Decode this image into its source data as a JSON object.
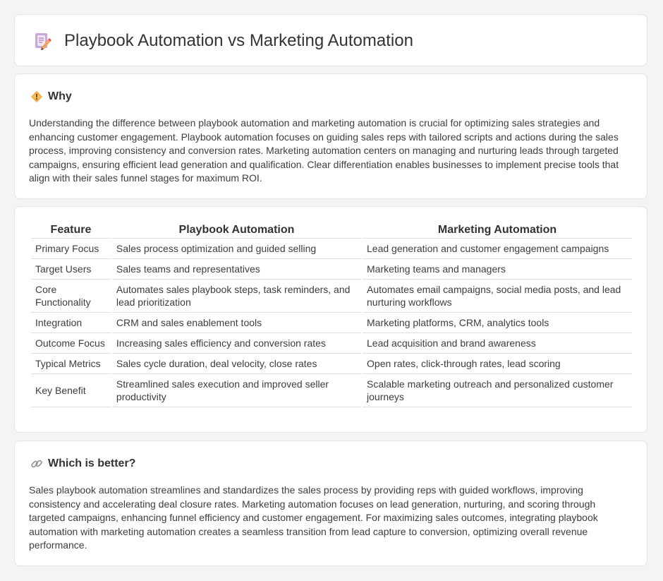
{
  "header": {
    "title": "Playbook Automation vs Marketing Automation"
  },
  "why": {
    "title": "Why",
    "text": "Understanding the difference between playbook automation and marketing automation is crucial for optimizing sales strategies and enhancing customer engagement. Playbook automation focuses on guiding sales reps with tailored scripts and actions during the sales process, improving consistency and conversion rates. Marketing automation centers on managing and nurturing leads through targeted campaigns, ensuring efficient lead generation and qualification. Clear differentiation enables businesses to implement precise tools that align with their sales funnel stages for maximum ROI."
  },
  "table": {
    "headers": [
      "Feature",
      "Playbook Automation",
      "Marketing Automation"
    ],
    "rows": [
      [
        "Primary Focus",
        "Sales process optimization and guided selling",
        "Lead generation and customer engagement campaigns"
      ],
      [
        "Target Users",
        "Sales teams and representatives",
        "Marketing teams and managers"
      ],
      [
        "Core Functionality",
        "Automates sales playbook steps, task reminders, and lead prioritization",
        "Automates email campaigns, social media posts, and lead nurturing workflows"
      ],
      [
        "Integration",
        "CRM and sales enablement tools",
        "Marketing platforms, CRM, analytics tools"
      ],
      [
        "Outcome Focus",
        "Increasing sales efficiency and conversion rates",
        "Lead acquisition and brand awareness"
      ],
      [
        "Typical Metrics",
        "Sales cycle duration, deal velocity, close rates",
        "Open rates, click-through rates, lead scoring"
      ],
      [
        "Key Benefit",
        "Streamlined sales execution and improved seller productivity",
        "Scalable marketing outreach and personalized customer journeys"
      ]
    ]
  },
  "better": {
    "title": "Which is better?",
    "text": "Sales playbook automation streamlines and standardizes the sales process by providing reps with guided workflows, improving consistency and accelerating deal closure rates. Marketing automation focuses on lead generation, nurturing, and scoring through targeted campaigns, enhancing funnel efficiency and customer engagement. For maximizing sales outcomes, integrating playbook automation with marketing automation creates a seamless transition from lead capture to conversion, optimizing overall revenue performance."
  },
  "icons": {
    "header": "document-pencil-icon",
    "why": "diamond-sign-icon",
    "better": "link-icon"
  }
}
